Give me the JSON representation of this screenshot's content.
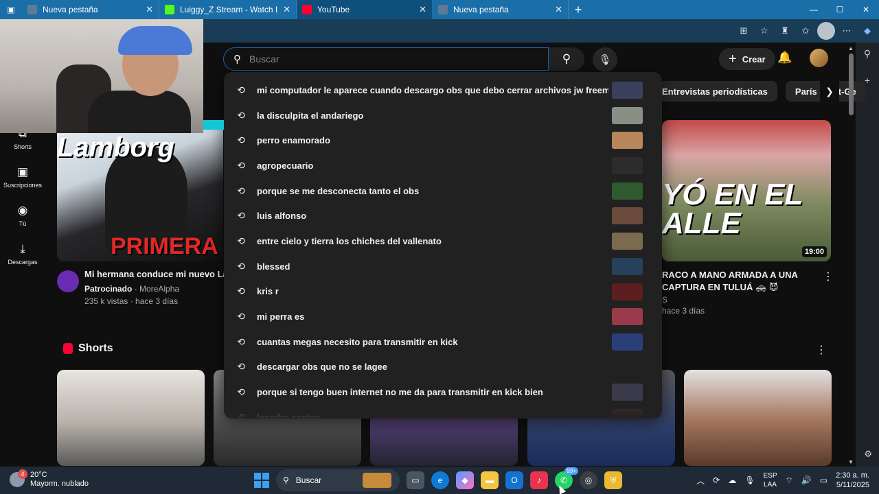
{
  "browser": {
    "tabs": [
      {
        "title": "Nueva pestaña",
        "favicon_color": "#5f7a92",
        "active": false
      },
      {
        "title": "Luiggy_Z Stream - Watch Live on",
        "favicon_color": "#53fc18",
        "active": false
      },
      {
        "title": "YouTube",
        "favicon_color": "#ff0033",
        "active": true
      },
      {
        "title": "Nueva pestaña",
        "favicon_color": "#5f7a92",
        "active": false
      }
    ],
    "close_glyph": "✕",
    "newtab_glyph": "+",
    "window_controls": {
      "minimize": "—",
      "maximize": "☐",
      "close": "✕"
    },
    "address_icons": [
      "apps-icon",
      "favorite-icon",
      "extensions-icon",
      "favorites-icon",
      "profile-icon",
      "more-icon",
      "copilot-icon"
    ]
  },
  "youtube": {
    "search": {
      "placeholder": "Buscar",
      "value": ""
    },
    "create_label": "Crear",
    "chips": [
      "Entrevistas periodísticas",
      "París Saint-Ge"
    ],
    "guide": [
      {
        "label": "Shorts",
        "icon": "shorts-icon"
      },
      {
        "label": "Suscripciones",
        "icon": "subscriptions-icon"
      },
      {
        "label": "Tú",
        "icon": "you-icon"
      },
      {
        "label": "Descargas",
        "icon": "downloads-icon"
      }
    ],
    "video_left": {
      "thumb_text_top": "Lamborg",
      "thumb_text_bottom": "PRIMERA V",
      "title": "Mi hermana conduce mi nuevo La",
      "sponsored": "Patrocinado",
      "channel": "MoreAlpha",
      "stats": "235 k vistas · hace 3 días"
    },
    "video_right": {
      "thumb_text": "YÓ EN EL\nALLE",
      "duration": "19:00",
      "title": "RACO A MANO ARMADA A UNA CAPTURA EN TULUÁ 🚓 😈",
      "channel": "S",
      "stats": "hace 3 días"
    },
    "shorts_title": "Shorts",
    "suggestions": [
      {
        "text": "mi computador le aparece cuando descargo obs que debo cerrar archivos jw freemarc",
        "thumb": "#3a3f5c"
      },
      {
        "text": "la disculpita el andariego",
        "thumb": "#8a8f86"
      },
      {
        "text": "perro enamorado",
        "thumb": "#b8885c"
      },
      {
        "text": "agropecuario",
        "thumb": "#2c2c2c"
      },
      {
        "text": "porque se me desconecta tanto el obs",
        "thumb": "#2f5a2f"
      },
      {
        "text": "luis alfonso",
        "thumb": "#6a4a3a"
      },
      {
        "text": "entre cielo y tierra los chiches del vallenato",
        "thumb": "#7a6a50"
      },
      {
        "text": "blessed",
        "thumb": "#27405c"
      },
      {
        "text": "kris r",
        "thumb": "#5c1e1e"
      },
      {
        "text": "mi perra es",
        "thumb": "#9a3a4a"
      },
      {
        "text": "cuantas megas necesito para transmitir en kick",
        "thumb": "#2a3f7a"
      },
      {
        "text": "descargar obs que no se lagee",
        "thumb": "#212121"
      },
      {
        "text": "porque si tengo buen internet no me da para transmitir en kick bien",
        "thumb": "#3a3a4a"
      },
      {
        "text": "leandro santos",
        "thumb": "#4a2a2a"
      }
    ]
  },
  "taskbar": {
    "weather_temp": "20°C",
    "weather_desc": "Mayorm. nublado",
    "weather_badge": "4",
    "search_label": "Buscar",
    "whatsapp_count": "99+",
    "lang_line1": "ESP",
    "lang_line2": "LAA",
    "time": "2:30 a. m.",
    "date": "5/11/2025"
  }
}
